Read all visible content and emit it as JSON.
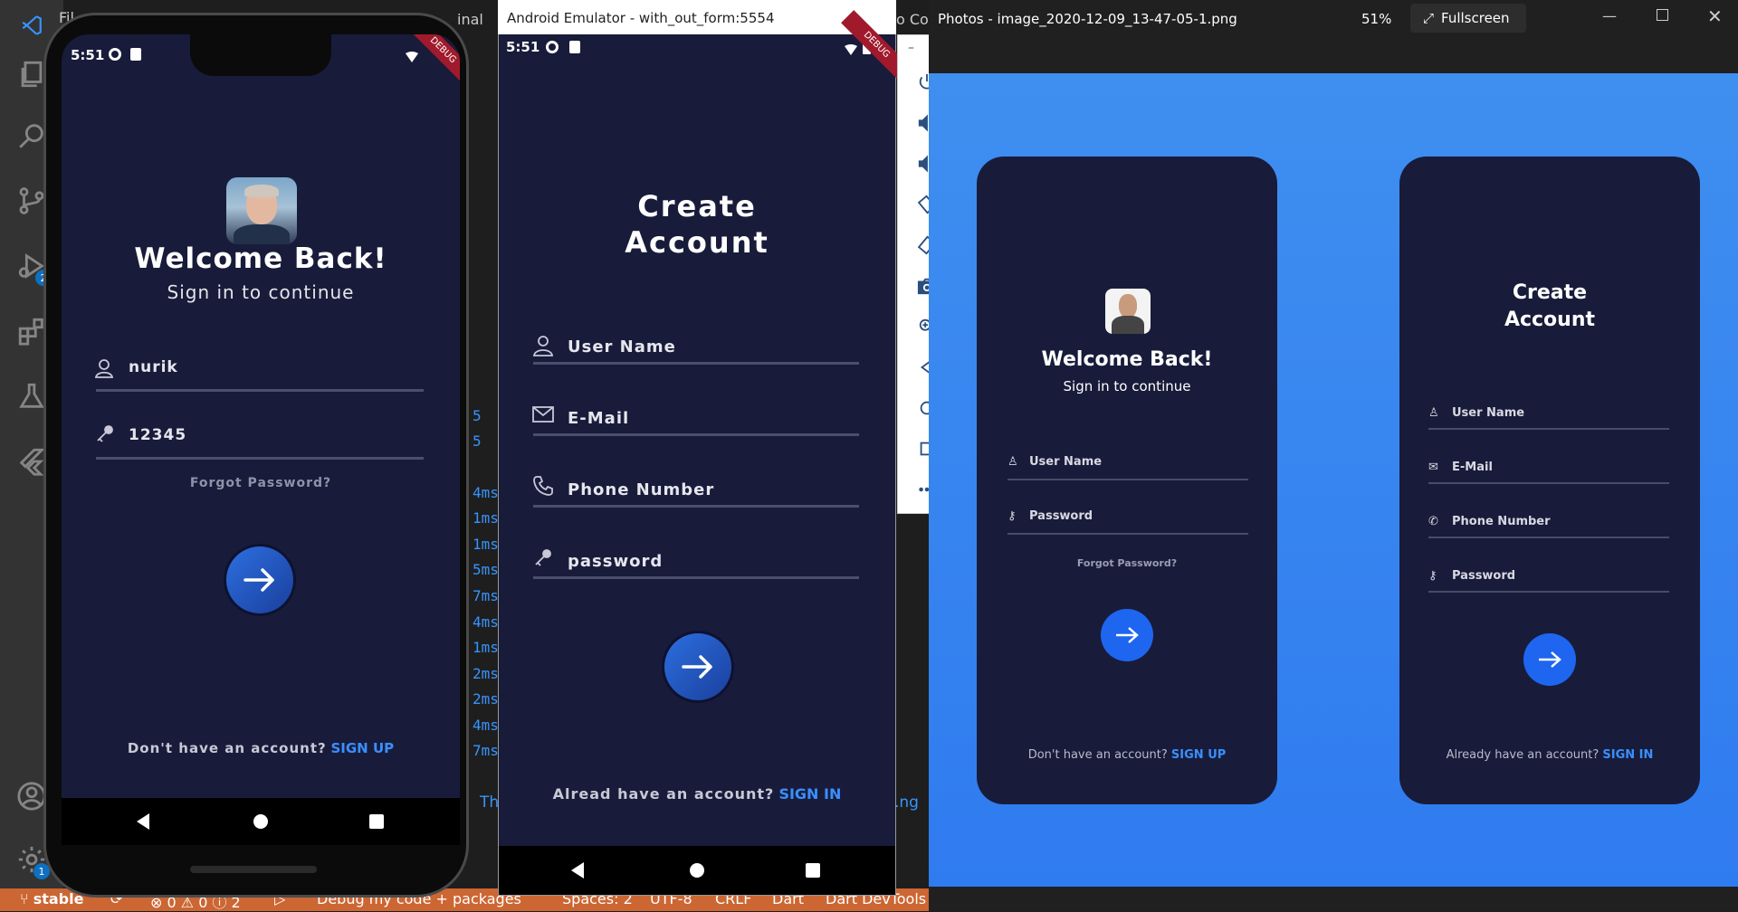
{
  "vscode": {
    "menu_partial": "Fil",
    "partial_right_1": "inal",
    "partial_right_2": "o Co",
    "log_lines": [
      "5",
      "5",
      "4ms",
      "1ms",
      "1ms",
      "5ms",
      "7ms",
      "4ms",
      "1ms",
      "2ms",
      "2ms",
      "4ms",
      "7ms"
    ],
    "log_partial_bottom_left": "Th",
    "log_partial_bottom_right": ".ng",
    "activity_badges": {
      "debug": "2",
      "settings": "1"
    },
    "statusbar": {
      "branch": "stable",
      "errors": "⊗ 0 ⚠ 0 ⓘ 2",
      "debug_config": "Debug my code + packages",
      "spaces": "Spaces: 2",
      "encoding": "UTF-8",
      "eol": "CRLF",
      "language": "Dart",
      "devtools": "Dart DevTools"
    }
  },
  "phone1": {
    "time": "5:51",
    "debug_banner": "DEBUG",
    "welcome_title": "Welcome Back!",
    "welcome_subtitle": "Sign in to continue",
    "username_value": "nurik",
    "password_value": "12345",
    "forgot_password": "Forgot Password?",
    "no_account_text": "Don't have an account?",
    "sign_up_link": "SIGN UP"
  },
  "emulator": {
    "window_title": "Android Emulator - with_out_form:5554",
    "time": "5:51",
    "debug_banner": "DEBUG",
    "title_line1": "Create",
    "title_line2": "Account",
    "fields": [
      "User Name",
      "E-Mail",
      "Phone Number",
      "password"
    ],
    "have_account_text": "Alread have an account?",
    "sign_in_link": "SIGN IN",
    "window_controls": {
      "minimize": "–",
      "close": "×"
    },
    "tools": [
      "power-icon",
      "volume-up-icon",
      "volume-down-icon",
      "rotate-left-icon",
      "rotate-right-icon",
      "camera-icon",
      "zoom-icon",
      "back-icon",
      "home-icon",
      "overview-icon",
      "more-icon"
    ]
  },
  "photos": {
    "title": "Photos - image_2020-12-09_13-47-05-1.png",
    "zoom": "51%",
    "fullscreen_label": "Fullscreen",
    "card_left": {
      "title": "Welcome Back!",
      "subtitle": "Sign in to continue",
      "fields": [
        "User Name",
        "Password"
      ],
      "forgot_password": "Forgot Password?",
      "no_account_text": "Don't have an account?",
      "sign_up_link": "SIGN UP"
    },
    "card_right": {
      "title_line1": "Create",
      "title_line2": "Account",
      "fields": [
        "User Name",
        "E-Mail",
        "Phone Number",
        "Password"
      ],
      "have_account_text": "Already have an account?",
      "sign_in_link": "SIGN IN"
    }
  },
  "colors": {
    "screen_bg": "#181c3a",
    "accent_link": "#3a8fff",
    "photo_bg": "#3f8ff0",
    "statusbar": "#cc6633"
  }
}
